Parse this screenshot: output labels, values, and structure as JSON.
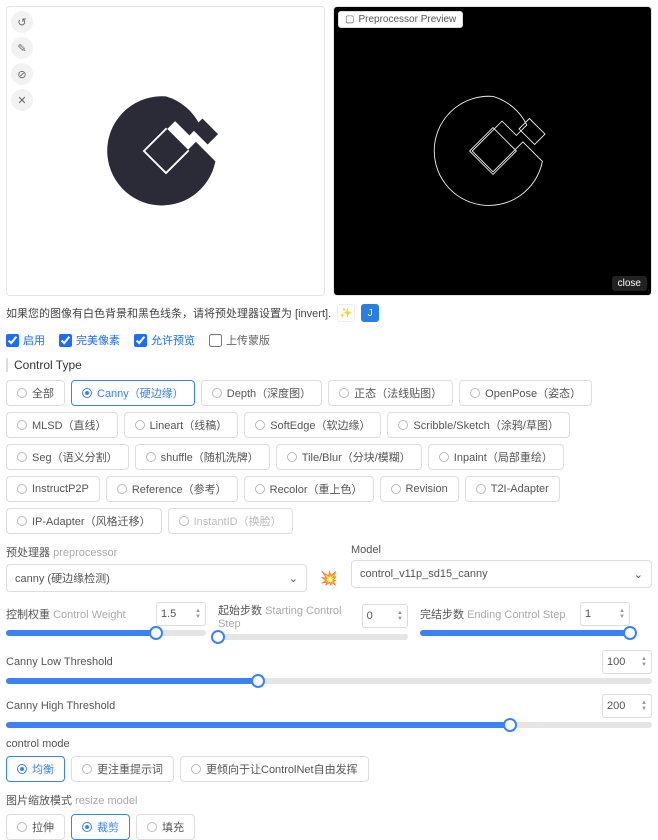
{
  "images": {
    "preview_tag": "Preprocessor Preview",
    "close": "close"
  },
  "hint": {
    "text": "如果您的图像有白色背景和黑色线条，请将预处理器设置为 [invert]."
  },
  "checks": {
    "enable": "启用",
    "perfect_pixel": "完美像素",
    "allow_preview": "允许预览",
    "upload_mask": "上传蒙版"
  },
  "control_type": {
    "title": "Control Type",
    "options": [
      {
        "label": "全部",
        "selected": false
      },
      {
        "label": "Canny（硬边缘）",
        "selected": true
      },
      {
        "label": "Depth（深度图）",
        "selected": false
      },
      {
        "label": "正态（法线贴图）",
        "selected": false
      },
      {
        "label": "OpenPose（姿态）",
        "selected": false
      },
      {
        "label": "MLSD（直线）",
        "selected": false
      },
      {
        "label": "Lineart（线稿）",
        "selected": false
      },
      {
        "label": "SoftEdge（软边缘）",
        "selected": false
      },
      {
        "label": "Scribble/Sketch（涂鸦/草图）",
        "selected": false
      },
      {
        "label": "Seg（语义分割）",
        "selected": false
      },
      {
        "label": "shuffle（随机洗牌）",
        "selected": false
      },
      {
        "label": "Tile/Blur（分块/模糊）",
        "selected": false
      },
      {
        "label": "Inpaint（局部重绘）",
        "selected": false
      },
      {
        "label": "InstructP2P",
        "selected": false
      },
      {
        "label": "Reference（参考）",
        "selected": false
      },
      {
        "label": "Recolor（重上色）",
        "selected": false
      },
      {
        "label": "Revision",
        "selected": false
      },
      {
        "label": "T2I-Adapter",
        "selected": false
      },
      {
        "label": "IP-Adapter（风格迁移）",
        "selected": false
      },
      {
        "label": "InstantID（换脸）",
        "selected": false,
        "disabled": true
      }
    ]
  },
  "preprocessor": {
    "label": "预处理器",
    "label_sub": "preprocessor",
    "value": "canny (硬边缘检测)"
  },
  "model": {
    "label": "Model",
    "value": "control_v11p_sd15_canny"
  },
  "sliders": {
    "weight": {
      "label": "控制权重",
      "label_sub": "Control Weight",
      "value": "1.5",
      "percent": 75
    },
    "start": {
      "label": "起始步数",
      "label_sub": "Starting Control Step",
      "value": "0",
      "percent": 0
    },
    "end": {
      "label": "完结步数",
      "label_sub": "Ending Control Step",
      "value": "1",
      "percent": 100
    },
    "canny_low": {
      "label": "Canny Low Threshold",
      "value": "100",
      "percent": 39
    },
    "canny_high": {
      "label": "Canny High Threshold",
      "value": "200",
      "percent": 78
    }
  },
  "control_mode": {
    "title": "control mode",
    "options": [
      {
        "label": "均衡",
        "selected": true
      },
      {
        "label": "更注重提示词",
        "selected": false
      },
      {
        "label": "更倾向于让ControlNet自由发挥",
        "selected": false
      }
    ]
  },
  "resize_mode": {
    "title": "图片缩放模式",
    "title_sub": "resize model",
    "options": [
      {
        "label": "拉伸",
        "selected": false
      },
      {
        "label": "裁剪",
        "selected": true
      },
      {
        "label": "填充",
        "selected": false
      }
    ]
  }
}
